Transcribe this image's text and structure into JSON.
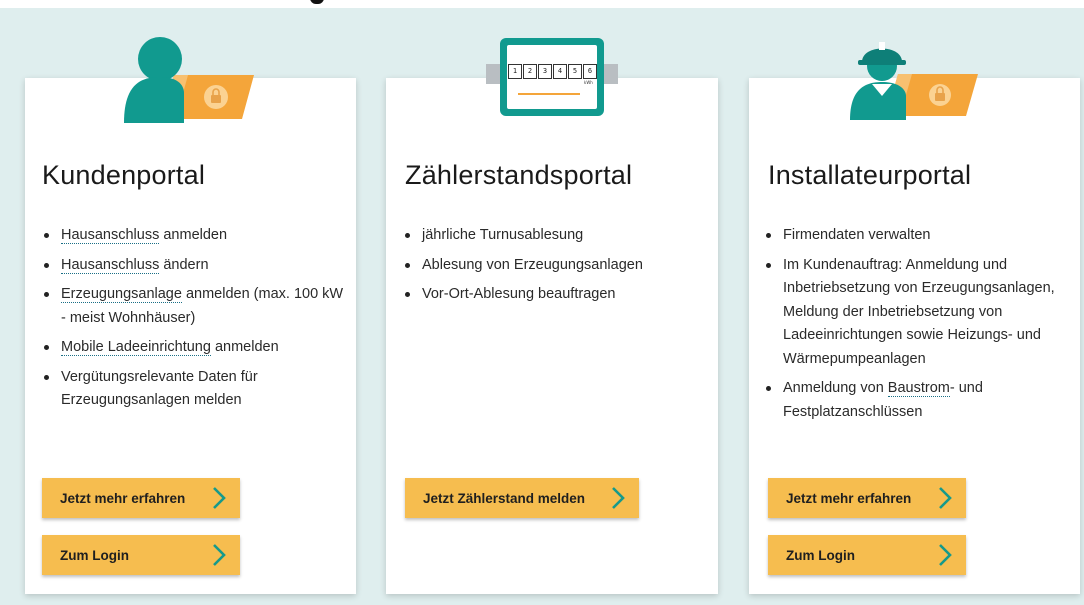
{
  "cards": [
    {
      "title": "Kundenportal",
      "features": [
        {
          "linked": "Hausanschluss",
          "rest": " anmelden"
        },
        {
          "linked": "Hausanschluss",
          "rest": " ändern"
        },
        {
          "linked": "Erzeugungsanlage",
          "rest": " anmelden (max. 100 kW - meist Wohnhäuser)"
        },
        {
          "linked": "Mobile Ladeeinrichtung",
          "rest": " anmelden"
        },
        {
          "linked": "",
          "rest": "Vergütungsrelevante Daten für Erzeugungsanlagen melden"
        }
      ],
      "buttons": [
        "Jetzt mehr erfahren",
        "Zum Login"
      ]
    },
    {
      "title": "Zählerstandsportal",
      "features": [
        {
          "linked": "",
          "rest": "jährliche Turnusablesung"
        },
        {
          "linked": "",
          "rest": "Ablesung von Erzeugungsanlagen"
        },
        {
          "linked": "",
          "rest": "Vor-Ort-Ablesung beauftragen"
        }
      ],
      "buttons": [
        "Jetzt Zählerstand melden"
      ]
    },
    {
      "title": "Installateurportal",
      "features": [
        {
          "linked": "",
          "rest": "Firmendaten verwalten"
        },
        {
          "linked": "",
          "rest": "Im Kundenauftrag: Anmeldung und Inbetriebsetzung von Erzeugungsanlagen, Meldung der Inbetriebsetzung von Ladeeinrichtungen sowie Heizungs- und Wärmepumpeanlagen"
        },
        {
          "pre": "Anmeldung von ",
          "linked": "Baustrom",
          "rest": "- und Festplatzanschlüssen"
        }
      ],
      "buttons": [
        "Jetzt mehr erfahren",
        "Zum Login"
      ]
    }
  ],
  "meter_display": {
    "digits": [
      "1",
      "2",
      "3",
      "4",
      "5",
      "6"
    ],
    "unit": "kWh"
  },
  "colors": {
    "teal": "#119a8f",
    "teal_dark": "#0e7f78",
    "orange": "#f4a53a",
    "button": "#f6bd4f",
    "chevron": "#169a8b",
    "background": "#dfeeee"
  },
  "icons": [
    "customer-lock-icon",
    "meter-icon",
    "installer-lock-icon",
    "chevron-right-icon"
  ]
}
